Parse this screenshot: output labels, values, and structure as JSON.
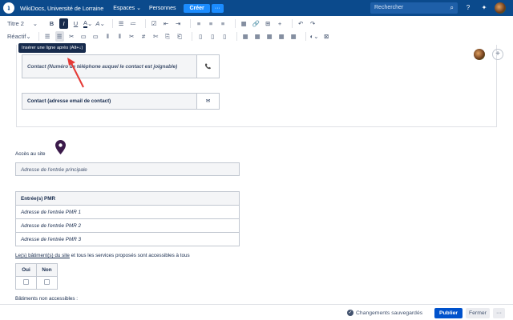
{
  "topbar": {
    "site_name": "WikiDocs, Université de Lorraine",
    "spaces": "Espaces",
    "people": "Personnes",
    "create": "Créer",
    "more": "···",
    "search_placeholder": "Rechercher"
  },
  "toolbar1": {
    "style": "Titre 2",
    "bold": "B",
    "italic": "I",
    "underline": "U",
    "text_color": "A",
    "more_format": "A",
    "bullet_list": "☰",
    "numbered_list": "≔",
    "task": "☑",
    "outdent": "⇤",
    "indent": "⇥",
    "align_left": "≡",
    "align_center": "≡",
    "align_right": "≡",
    "layout": "▦",
    "link": "🔗",
    "table": "⊞",
    "insert": "+",
    "undo": "↶",
    "redo": "↷"
  },
  "toolbar2": {
    "mode": "Réactif",
    "row_before": "☰",
    "row_after": "☰",
    "delete_row": "✂",
    "merge": "▭",
    "split": "▭",
    "col_before": "⫴",
    "col_after": "⫴",
    "delete_col": "✂",
    "number": "#",
    "cut": "✄",
    "copy": "⎘",
    "paste": "⎗",
    "c1": "▯",
    "c2": "▯",
    "c3": "▯",
    "t1": "▦",
    "t2": "▦",
    "t3": "▦",
    "t4": "▦",
    "t5": "▦",
    "color": "◐",
    "delete_table": "⊠"
  },
  "tooltip": "Insérer une ligne après (Alt+↓)",
  "contact_phone": {
    "label": "Contact (Numéro de téléphone auquel le contact est joignable)",
    "icon": "📞"
  },
  "contact_email": {
    "label": "Contact (adresse email de contact)",
    "icon": "✉"
  },
  "acces_label": "Accès au site",
  "main_entrance": "Adresse de l'entrée principale",
  "pmr": {
    "header": "Entrée(s) PMR",
    "rows": [
      "Adresse de l'entrée PMR 1",
      "Adresse de l'entrée PMR 2",
      "Adresse de l'entrée PMR 3"
    ]
  },
  "accessibility": {
    "link": "Le(s) bâtiment(s) du site",
    "rest": " et tous les services proposés sont accessibles à tous",
    "yes": "Oui",
    "no": "Non"
  },
  "non_accessible": "Bâtiments non accessibles :",
  "footer": {
    "saved": "Changements sauvegardés",
    "publish": "Publier",
    "close": "Fermer",
    "more": "···"
  },
  "colors": {
    "topbar": "#0b4a8c",
    "create": "#1b8cff",
    "publish": "#0052cc"
  }
}
